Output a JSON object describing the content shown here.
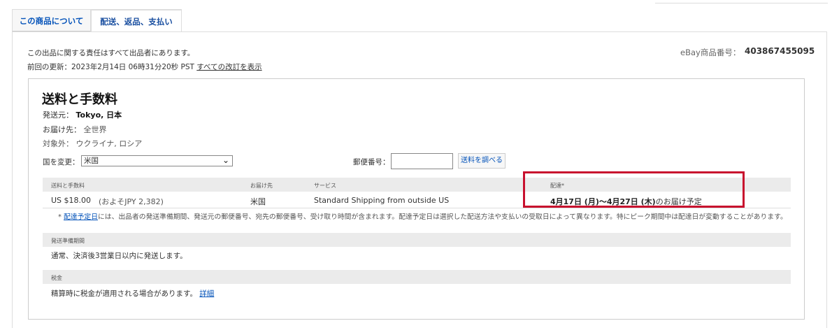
{
  "tabs": [
    {
      "label": "この商品について"
    },
    {
      "label": "配送、返品、支払い"
    }
  ],
  "header": {
    "responsibility": "この出品に関する責任はすべて出品者にあります。",
    "updated_prefix": "前回の更新：",
    "updated_date": "2023年2月14日 06時31分20秒 PST",
    "revisions_link": "すべての改訂を表示",
    "item_number_label": "eBay商品番号：",
    "item_number": "403867455095"
  },
  "shipping": {
    "title": "送料と手数料",
    "from_label": "発送元：",
    "from_value": "Tokyo, 日本",
    "to_label": "お届け先：",
    "to_value": "全世界",
    "excluded_label": "対象外：",
    "excluded_value": "ウクライナ, ロシア",
    "country_label": "国を変更：",
    "country_selected": "米国",
    "zip_label": "郵便番号：",
    "zip_value": "",
    "calc_button": "送料を調べる"
  },
  "table": {
    "headers": [
      "送料と手数料",
      "お届け先",
      "サービス",
      "配達*"
    ],
    "row": {
      "cost": "US $18.00",
      "approx": "(およそJPY 2,382)",
      "dest": "米国",
      "service": "Standard Shipping from outside US",
      "delivery": "4月17日 (月)〜4月27日 (木)",
      "delivery_suffix": "のお届け予定"
    },
    "note_prefix": "* ",
    "note_link": "配達予定日",
    "note_text": "には、出品者の発送準備期間、発送元の郵便番号、宛先の郵便番号、受け取り時間が含まれます。配達予定日は選択した配送方法や支払いの受取日によって異なります。特にピーク期間中は配達日が変動することがあります。"
  },
  "handling": {
    "heading": "発送準備期間",
    "text": "通常、決済後3営業日以内に発送します。"
  },
  "tax": {
    "heading": "税金",
    "text": "精算時に税金が適用される場合があります。",
    "link": "詳細"
  },
  "colors": {
    "highlight": "#c8102e",
    "link": "#0654ba"
  }
}
